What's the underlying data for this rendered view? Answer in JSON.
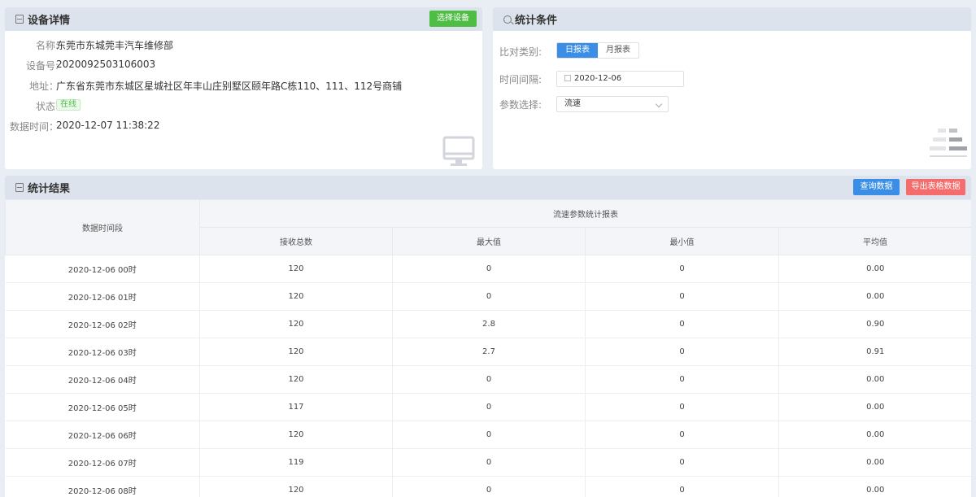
{
  "device": {
    "title": "设备详情",
    "select_button": "选择设备",
    "name_label": "名称:",
    "name_value": "东莞市东城莞丰汽车维修部",
    "id_label": "设备号:",
    "id_value": "2020092503106003",
    "addr_label": "地址：",
    "addr_value": "广东省东莞市东城区星城社区年丰山庄别墅区颐年路C栋110、111、112号商铺",
    "status_label": "状态:",
    "status_value": "在线",
    "time_label": "数据时间：",
    "time_value": "2020-12-07 11:38:22"
  },
  "conditions": {
    "title": "统计条件",
    "compare_label": "比对类别:",
    "daily": "日报表",
    "monthly": "月报表",
    "interval_label": "时间间隔:",
    "date_value": "2020-12-06",
    "param_label": "参数选择:",
    "param_value": "流速"
  },
  "result": {
    "title": "统计结果",
    "query_button": "查询数据",
    "export_button": "导出表格数据",
    "col_time": "数据时间段",
    "group_header": "流速参数统计报表",
    "columns": [
      "接收总数",
      "最大值",
      "最小值",
      "平均值"
    ],
    "rows": [
      [
        "2020-12-06 00时",
        "120",
        "0",
        "0",
        "0.00"
      ],
      [
        "2020-12-06 01时",
        "120",
        "0",
        "0",
        "0.00"
      ],
      [
        "2020-12-06 02时",
        "120",
        "2.8",
        "0",
        "0.90"
      ],
      [
        "2020-12-06 03时",
        "120",
        "2.7",
        "0",
        "0.91"
      ],
      [
        "2020-12-06 04时",
        "120",
        "0",
        "0",
        "0.00"
      ],
      [
        "2020-12-06 05时",
        "117",
        "0",
        "0",
        "0.00"
      ],
      [
        "2020-12-06 06时",
        "120",
        "0",
        "0",
        "0.00"
      ],
      [
        "2020-12-06 07时",
        "119",
        "0",
        "0",
        "0.00"
      ],
      [
        "2020-12-06 08时",
        "120",
        "0",
        "0",
        "0.00"
      ]
    ]
  },
  "colors": {
    "accent_blue": "#3a8ee6",
    "green": "#4dbd43",
    "red": "#f56c6c"
  }
}
